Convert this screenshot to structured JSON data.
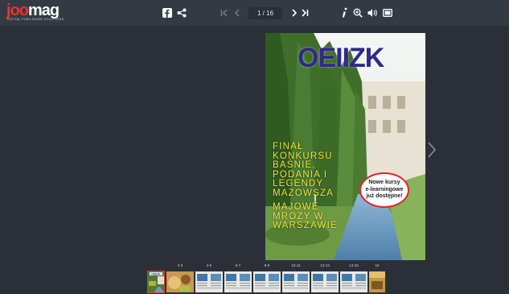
{
  "app": {
    "logo": {
      "accent": "joo",
      "main": "mag",
      "tagline": "DIGITAL PUBLISHING SOLUTIONS"
    },
    "page_counter": "1 / 16",
    "toolbar_icons": [
      "facebook-icon",
      "share-icon",
      "first-page-icon",
      "prev-page-icon",
      "next-page-icon",
      "last-page-icon",
      "info-icon",
      "zoom-in-icon",
      "sound-icon",
      "fullscreen-icon"
    ]
  },
  "cover": {
    "title": "OEIIZK",
    "lines": [
      "FINAŁ",
      "KONKURSU",
      "BAŚNIE,",
      "PODANIA I",
      "LEGENDY",
      "MAZOWSZA"
    ],
    "lines2": [
      "MAJOWE",
      "MROZY W",
      "WARSZAWIE"
    ],
    "badge": [
      "Nowe kursy",
      "e-learningowe",
      "już dostępne!"
    ]
  },
  "thumbnails": [
    {
      "label": "",
      "kind": "cover"
    },
    {
      "label": "2-3",
      "kind": "food"
    },
    {
      "label": "4-5",
      "kind": "article"
    },
    {
      "label": "6-7",
      "kind": "article"
    },
    {
      "label": "8-9",
      "kind": "article"
    },
    {
      "label": "10-11",
      "kind": "article"
    },
    {
      "label": "12-13",
      "kind": "article"
    },
    {
      "label": "14-15",
      "kind": "article"
    },
    {
      "label": "16",
      "kind": "back"
    }
  ],
  "colors": {
    "bg": "#2b3038",
    "toolbar": "#343a43",
    "accent": "#e8332a",
    "cover_title": "#2f2a87",
    "cover_text": "#f2e33a"
  }
}
